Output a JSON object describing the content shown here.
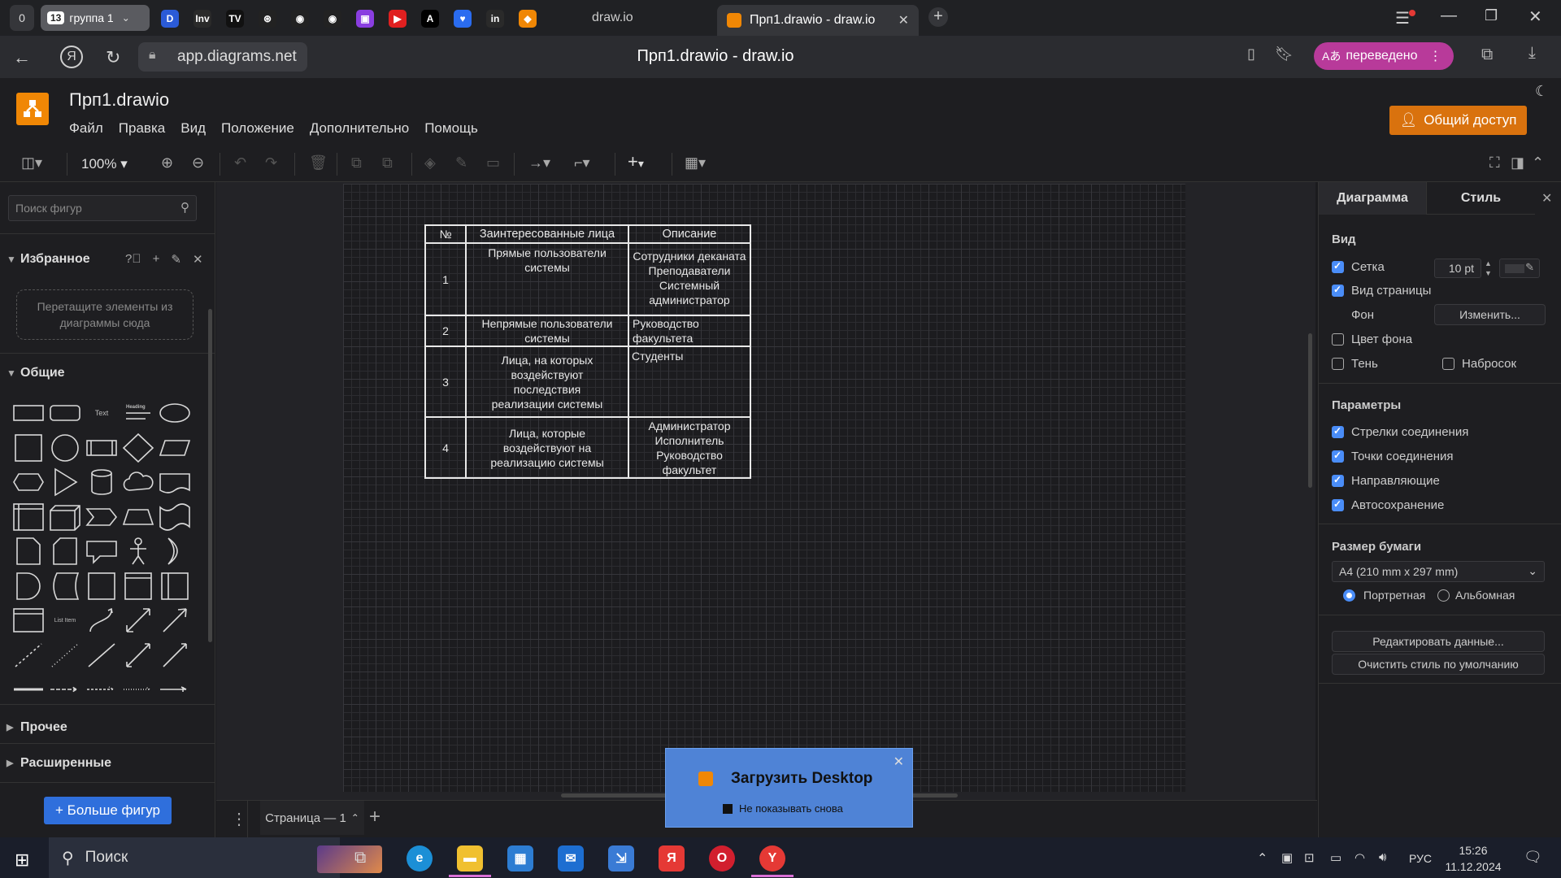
{
  "browser": {
    "tab_count": "0",
    "group_count": "13",
    "group_label": "группа 1",
    "tab_inactive_title": "draw.io",
    "tab_active_title": "Прп1.drawio - draw.io",
    "url": "app.diagrams.net",
    "page_title": "Прп1.drawio - draw.io",
    "translated_label": "переведено",
    "pinned": [
      {
        "name": "reader-icon",
        "text": "D",
        "color": "#2b5bd7"
      },
      {
        "name": "investing-icon",
        "text": "Inv",
        "color": "#2a2a2a"
      },
      {
        "name": "tradingview-icon",
        "text": "TV",
        "color": "#111"
      },
      {
        "name": "openai-icon",
        "text": "⊛",
        "color": "#222"
      },
      {
        "name": "github-icon",
        "text": "◉",
        "color": "#222"
      },
      {
        "name": "github-icon-2",
        "text": "◉",
        "color": "#222"
      },
      {
        "name": "twitch-icon",
        "text": "▣",
        "color": "#8a3ee0"
      },
      {
        "name": "youtube-icon",
        "text": "▶",
        "color": "#e02020"
      },
      {
        "name": "a-icon",
        "text": "A",
        "color": "#000"
      },
      {
        "name": "heart-icon",
        "text": "♥",
        "color": "#2a6cf0"
      },
      {
        "name": "in-icon",
        "text": "in",
        "color": "#2a2a2a"
      },
      {
        "name": "drawio-icon",
        "text": "◆",
        "color": "#f08705"
      }
    ]
  },
  "app": {
    "filename": "Прп1.drawio",
    "menu": [
      "Файл",
      "Правка",
      "Вид",
      "Положение",
      "Дополнительно",
      "Помощь"
    ],
    "share_label": "Общий доступ",
    "zoom": "100%",
    "accent": "#f08705"
  },
  "left": {
    "search_placeholder": "Поиск фигур",
    "favorites": "Избранное",
    "drop_hint": "Перетащите элементы из диаграммы сюда",
    "general": "Общие",
    "other": "Прочее",
    "advanced": "Расширенные",
    "more_shapes": "+ Больше фигур",
    "text_shape": "Text",
    "heading_shape": "Heading",
    "list_item_shape": "List Item"
  },
  "table": {
    "headers": [
      "№",
      "Заинтересованные лица",
      "Описание"
    ],
    "rows": [
      {
        "num": "1",
        "who": "Прямые пользователи системы",
        "desc": "Сотрудники деканата Преподаватели Системный администратор"
      },
      {
        "num": "2",
        "who": "Непрямые пользователи системы",
        "desc": "Руководство факультета"
      },
      {
        "num": "3",
        "who": "Лица, на которых воздействуют последствия реализации системы",
        "desc": "Студенты"
      },
      {
        "num": "4",
        "who": "Лица, которые воздействуют на реализацию системы",
        "desc": "Администратор Исполнитель Руководство факультет"
      }
    ]
  },
  "right": {
    "tab_diagram": "Диаграмма",
    "tab_style": "Стиль",
    "view": "Вид",
    "grid": "Сетка",
    "grid_size": "10 pt",
    "page_view": "Вид страницы",
    "background": "Фон",
    "change": "Изменить...",
    "bg_color": "Цвет фона",
    "shadow": "Тень",
    "sketch": "Набросок",
    "params": "Параметры",
    "conn_arrows": "Стрелки соединения",
    "conn_points": "Точки соединения",
    "guides": "Направляющие",
    "autosave": "Автосохранение",
    "paper_size": "Размер бумаги",
    "paper_value": "A4 (210 mm x 297 mm)",
    "portrait": "Портретная",
    "landscape": "Альбомная",
    "edit_data": "Редактировать данные...",
    "clear_style": "Очистить стиль по умолчанию"
  },
  "pages": {
    "page_tab": "Страница — 1"
  },
  "toast": {
    "title": "Загрузить Desktop",
    "dont_show": "Не показывать снова"
  },
  "taskbar": {
    "search": "Поиск",
    "lang": "РУС",
    "time": "15:26",
    "date": "11.12.2024"
  }
}
